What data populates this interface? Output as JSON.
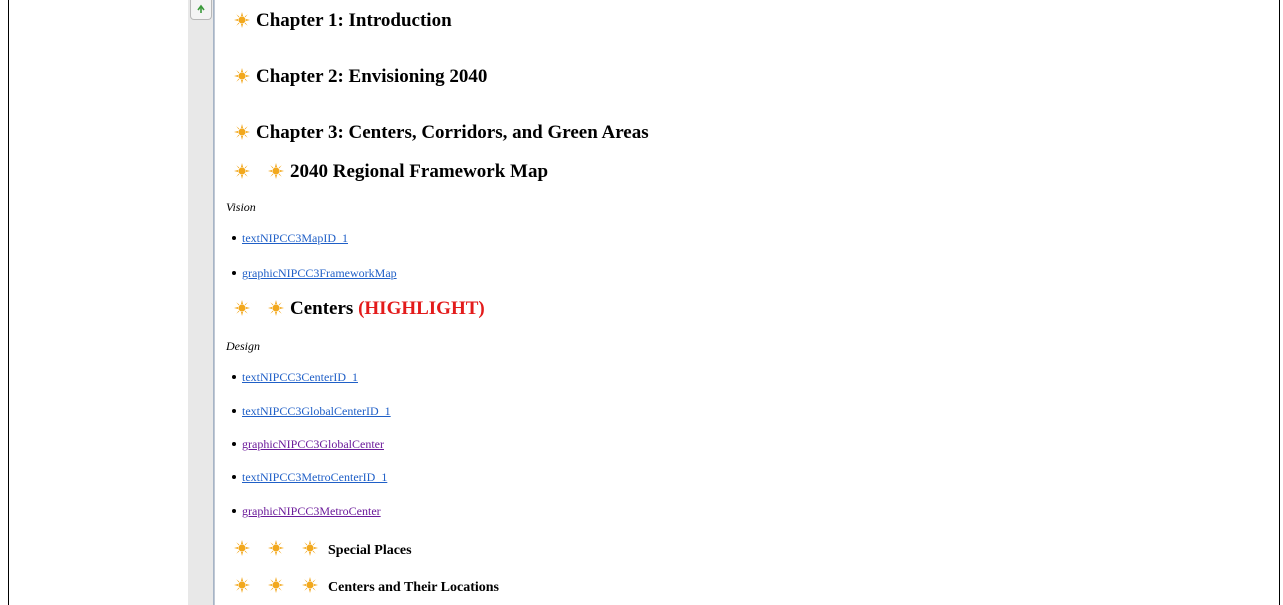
{
  "chapters": [
    {
      "title": "Chapter 1: Introduction"
    },
    {
      "title": "Chapter 2: Envisioning 2040"
    },
    {
      "title": "Chapter 3: Centers, Corridors, and Green Areas"
    }
  ],
  "framework_section": {
    "title": "2040 Regional Framework Map",
    "label": "Vision",
    "links": [
      "textNIPCC3MapID_1",
      "graphicNIPCC3FrameworkMap"
    ]
  },
  "centers_section": {
    "title": "Centers",
    "highlight": "(HIGHLIGHT)",
    "label": "Design",
    "links": [
      {
        "text": "textNIPCC3CenterID_1",
        "visited": false
      },
      {
        "text": "textNIPCC3GlobalCenterID_1",
        "visited": false
      },
      {
        "text": "graphicNIPCC3GlobalCenter",
        "visited": true
      },
      {
        "text": "textNIPCC3MetroCenterID_1",
        "visited": false
      },
      {
        "text": "graphicNIPCC3MetroCenter",
        "visited": true
      }
    ]
  },
  "subsections": [
    {
      "title": "Special Places"
    },
    {
      "title": "Centers and Their Locations"
    }
  ],
  "colors": {
    "link": "#1f5fc7",
    "visited_link": "#6b1a9a",
    "highlight": "#e31b1b",
    "sun_icon": "#f2a81d"
  },
  "icons": {
    "heading_marker": "sun-icon",
    "tool_button": "refresh-icon"
  }
}
